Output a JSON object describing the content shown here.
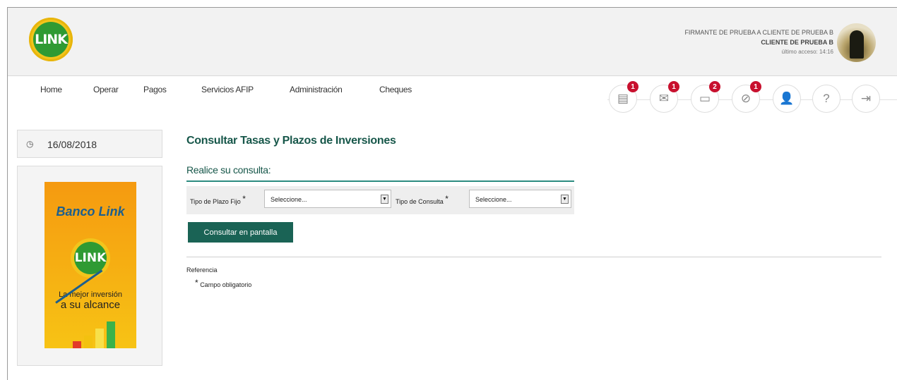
{
  "brand": {
    "logo_text": "LINK"
  },
  "user": {
    "signer": "FIRMANTE DE PRUEBA A CLIENTE DE PRUEBA B",
    "client": "CLIENTE DE PRUEBA B",
    "last_access": "último acceso: 14:16"
  },
  "nav": {
    "items": [
      "Home",
      "Operar",
      "Pagos",
      "Servicios AFIP",
      "Administración",
      "Cheques"
    ]
  },
  "toolbar": {
    "icons": [
      {
        "icon": "document-icon",
        "badge": "1"
      },
      {
        "icon": "mail-icon",
        "badge": "1"
      },
      {
        "icon": "folder-icon",
        "badge": "2"
      },
      {
        "icon": "attachment-icon",
        "badge": "1"
      },
      {
        "icon": "user-icon",
        "badge": ""
      },
      {
        "icon": "help-icon",
        "badge": ""
      },
      {
        "icon": "logout-icon",
        "badge": ""
      }
    ]
  },
  "sidebar": {
    "date": "16/08/2018",
    "promo": {
      "title": "Banco Link",
      "logo_text": "LINK",
      "tagline1": "La mejor inversión",
      "tagline2": "a su alcance"
    }
  },
  "main": {
    "title": "Consultar Tasas y Plazos de Inversiones",
    "subtitle": "Realice su consulta:",
    "filters": {
      "plazo_label": "Tipo de Plazo Fijo",
      "plazo_value": "Seleccione...",
      "consulta_label": "Tipo de Consulta",
      "consulta_value": "Seleccione...",
      "required_mark": "*"
    },
    "submit_label": "Consultar en pantalla",
    "reference_label": "Referencia",
    "required_note": "Campo obligatorio"
  },
  "colors": {
    "accent": "#17574a",
    "button": "#1a6355",
    "badge": "#c8102e",
    "logo_green": "#2f9a33",
    "logo_yellow": "#f2c51c"
  }
}
